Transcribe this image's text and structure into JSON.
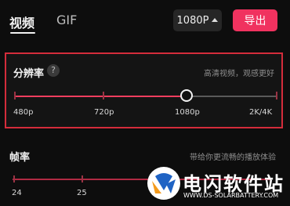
{
  "tabs": [
    {
      "label": "视频"
    },
    {
      "label": "GIF"
    }
  ],
  "resolution_select": {
    "value": "1080P"
  },
  "export_button": {
    "label": "导出"
  },
  "resolution": {
    "title": "分辨率",
    "help": "?",
    "hint": "高清视频，观感更好",
    "options": [
      "480p",
      "720p",
      "1080p",
      "2K/4K"
    ],
    "selected": "1080p"
  },
  "frame_rate": {
    "title": "帧率",
    "hint": "带给你更流畅的播放体验",
    "options": [
      "24",
      "25"
    ]
  },
  "watermark": {
    "text": "电闪软件站",
    "url": "WWW.DS-SOLARBATTERY.COM"
  },
  "colors": {
    "accent": "#f0325f",
    "highlight_border": "#d42c3b",
    "background": "#0d0d0d"
  }
}
